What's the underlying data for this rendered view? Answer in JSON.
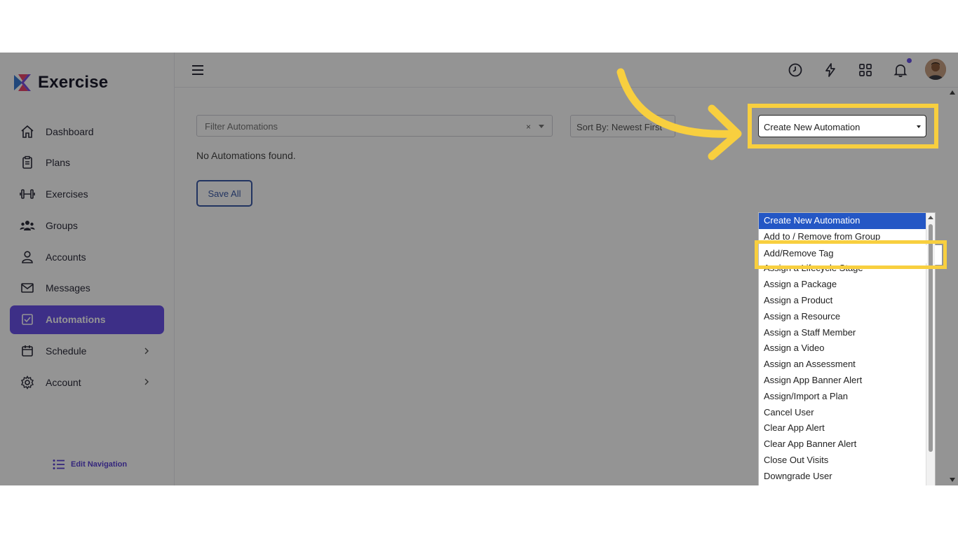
{
  "brand": {
    "name": "Exercise"
  },
  "sidebar": {
    "items": [
      {
        "label": "Dashboard",
        "icon": "home-icon"
      },
      {
        "label": "Plans",
        "icon": "clipboard-icon"
      },
      {
        "label": "Exercises",
        "icon": "dumbbell-icon"
      },
      {
        "label": "Groups",
        "icon": "users-icon"
      },
      {
        "label": "Accounts",
        "icon": "user-icon"
      },
      {
        "label": "Messages",
        "icon": "mail-icon"
      },
      {
        "label": "Automations",
        "icon": "checkbox-icon",
        "active": true
      },
      {
        "label": "Schedule",
        "icon": "calendar-icon",
        "has_children": true
      },
      {
        "label": "Account",
        "icon": "gear-icon",
        "has_children": true
      }
    ],
    "edit_nav_label": "Edit Navigation"
  },
  "topbar": {
    "icons": [
      "clock-icon",
      "lightning-icon",
      "grid-icon",
      "bell-icon"
    ],
    "notification_dot_color": "#6a51e8"
  },
  "filters": {
    "filter_placeholder": "Filter Automations",
    "clear_symbol": "×",
    "sort_label": "Sort By: Newest First"
  },
  "main": {
    "empty_message": "No Automations found.",
    "save_all_label": "Save All",
    "create_select_value": "Create New Automation"
  },
  "dropdown": {
    "options": [
      "Create New Automation",
      "Add to / Remove from Group",
      "Add/Remove Tag",
      "Assign a Lifecycle Stage",
      "Assign a Package",
      "Assign a Product",
      "Assign a Resource",
      "Assign a Staff Member",
      "Assign a Video",
      "Assign an Assessment",
      "Assign App Banner Alert",
      "Assign/Import a Plan",
      "Cancel User",
      "Clear App Alert",
      "Clear App Banner Alert",
      "Close Out Visits",
      "Downgrade User"
    ],
    "selected_index": 0,
    "highlighted_index": 2
  },
  "colors": {
    "accent": "#6a51e8",
    "highlight": "#f8cf3f",
    "selected_option": "#2457c5"
  }
}
